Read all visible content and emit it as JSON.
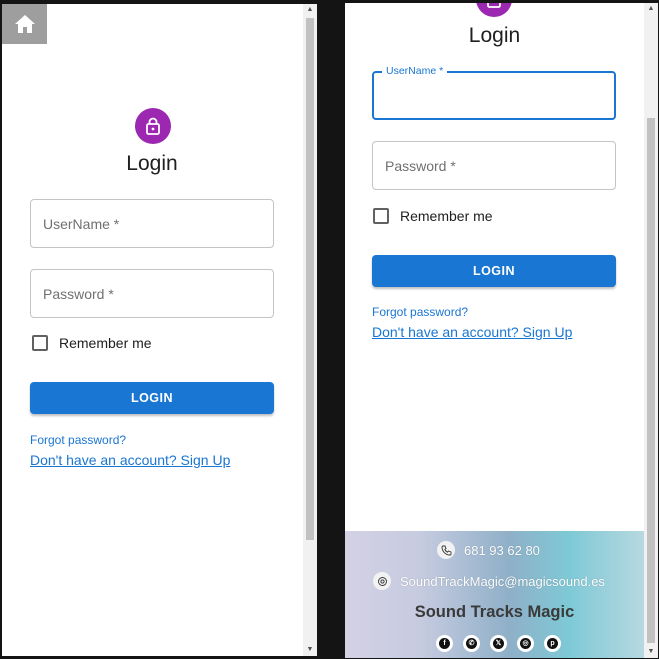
{
  "left": {
    "home_icon": "home-icon",
    "title": "Login",
    "username_placeholder": "UserName *",
    "password_placeholder": "Password *",
    "remember_label": "Remember me",
    "login_label": "LOGIN",
    "forgot_label": "Forgot password?",
    "signup_label": "Don't have an account? Sign Up"
  },
  "right": {
    "title": "Login",
    "username_label": "UserName *",
    "password_placeholder": "Password *",
    "remember_label": "Remember me",
    "login_label": "LOGIN",
    "forgot_label": "Forgot password?",
    "signup_label": "Don't have an account? Sign Up"
  },
  "footer": {
    "phone": "681 93 62 80",
    "email": "SoundTrackMagic@magicsound.es",
    "brand": "Sound Tracks Magic",
    "socials": [
      {
        "icon": "facebook-icon",
        "glyph": "f"
      },
      {
        "icon": "whatsapp-icon",
        "glyph": "✆"
      },
      {
        "icon": "x-icon",
        "glyph": "𝕏"
      },
      {
        "icon": "instagram-icon",
        "glyph": "◎"
      },
      {
        "icon": "pinterest-icon",
        "glyph": "p"
      }
    ]
  },
  "colors": {
    "accent": "#1976d2",
    "avatar": "#9c27b0",
    "home_button": "#9e9e9e"
  }
}
